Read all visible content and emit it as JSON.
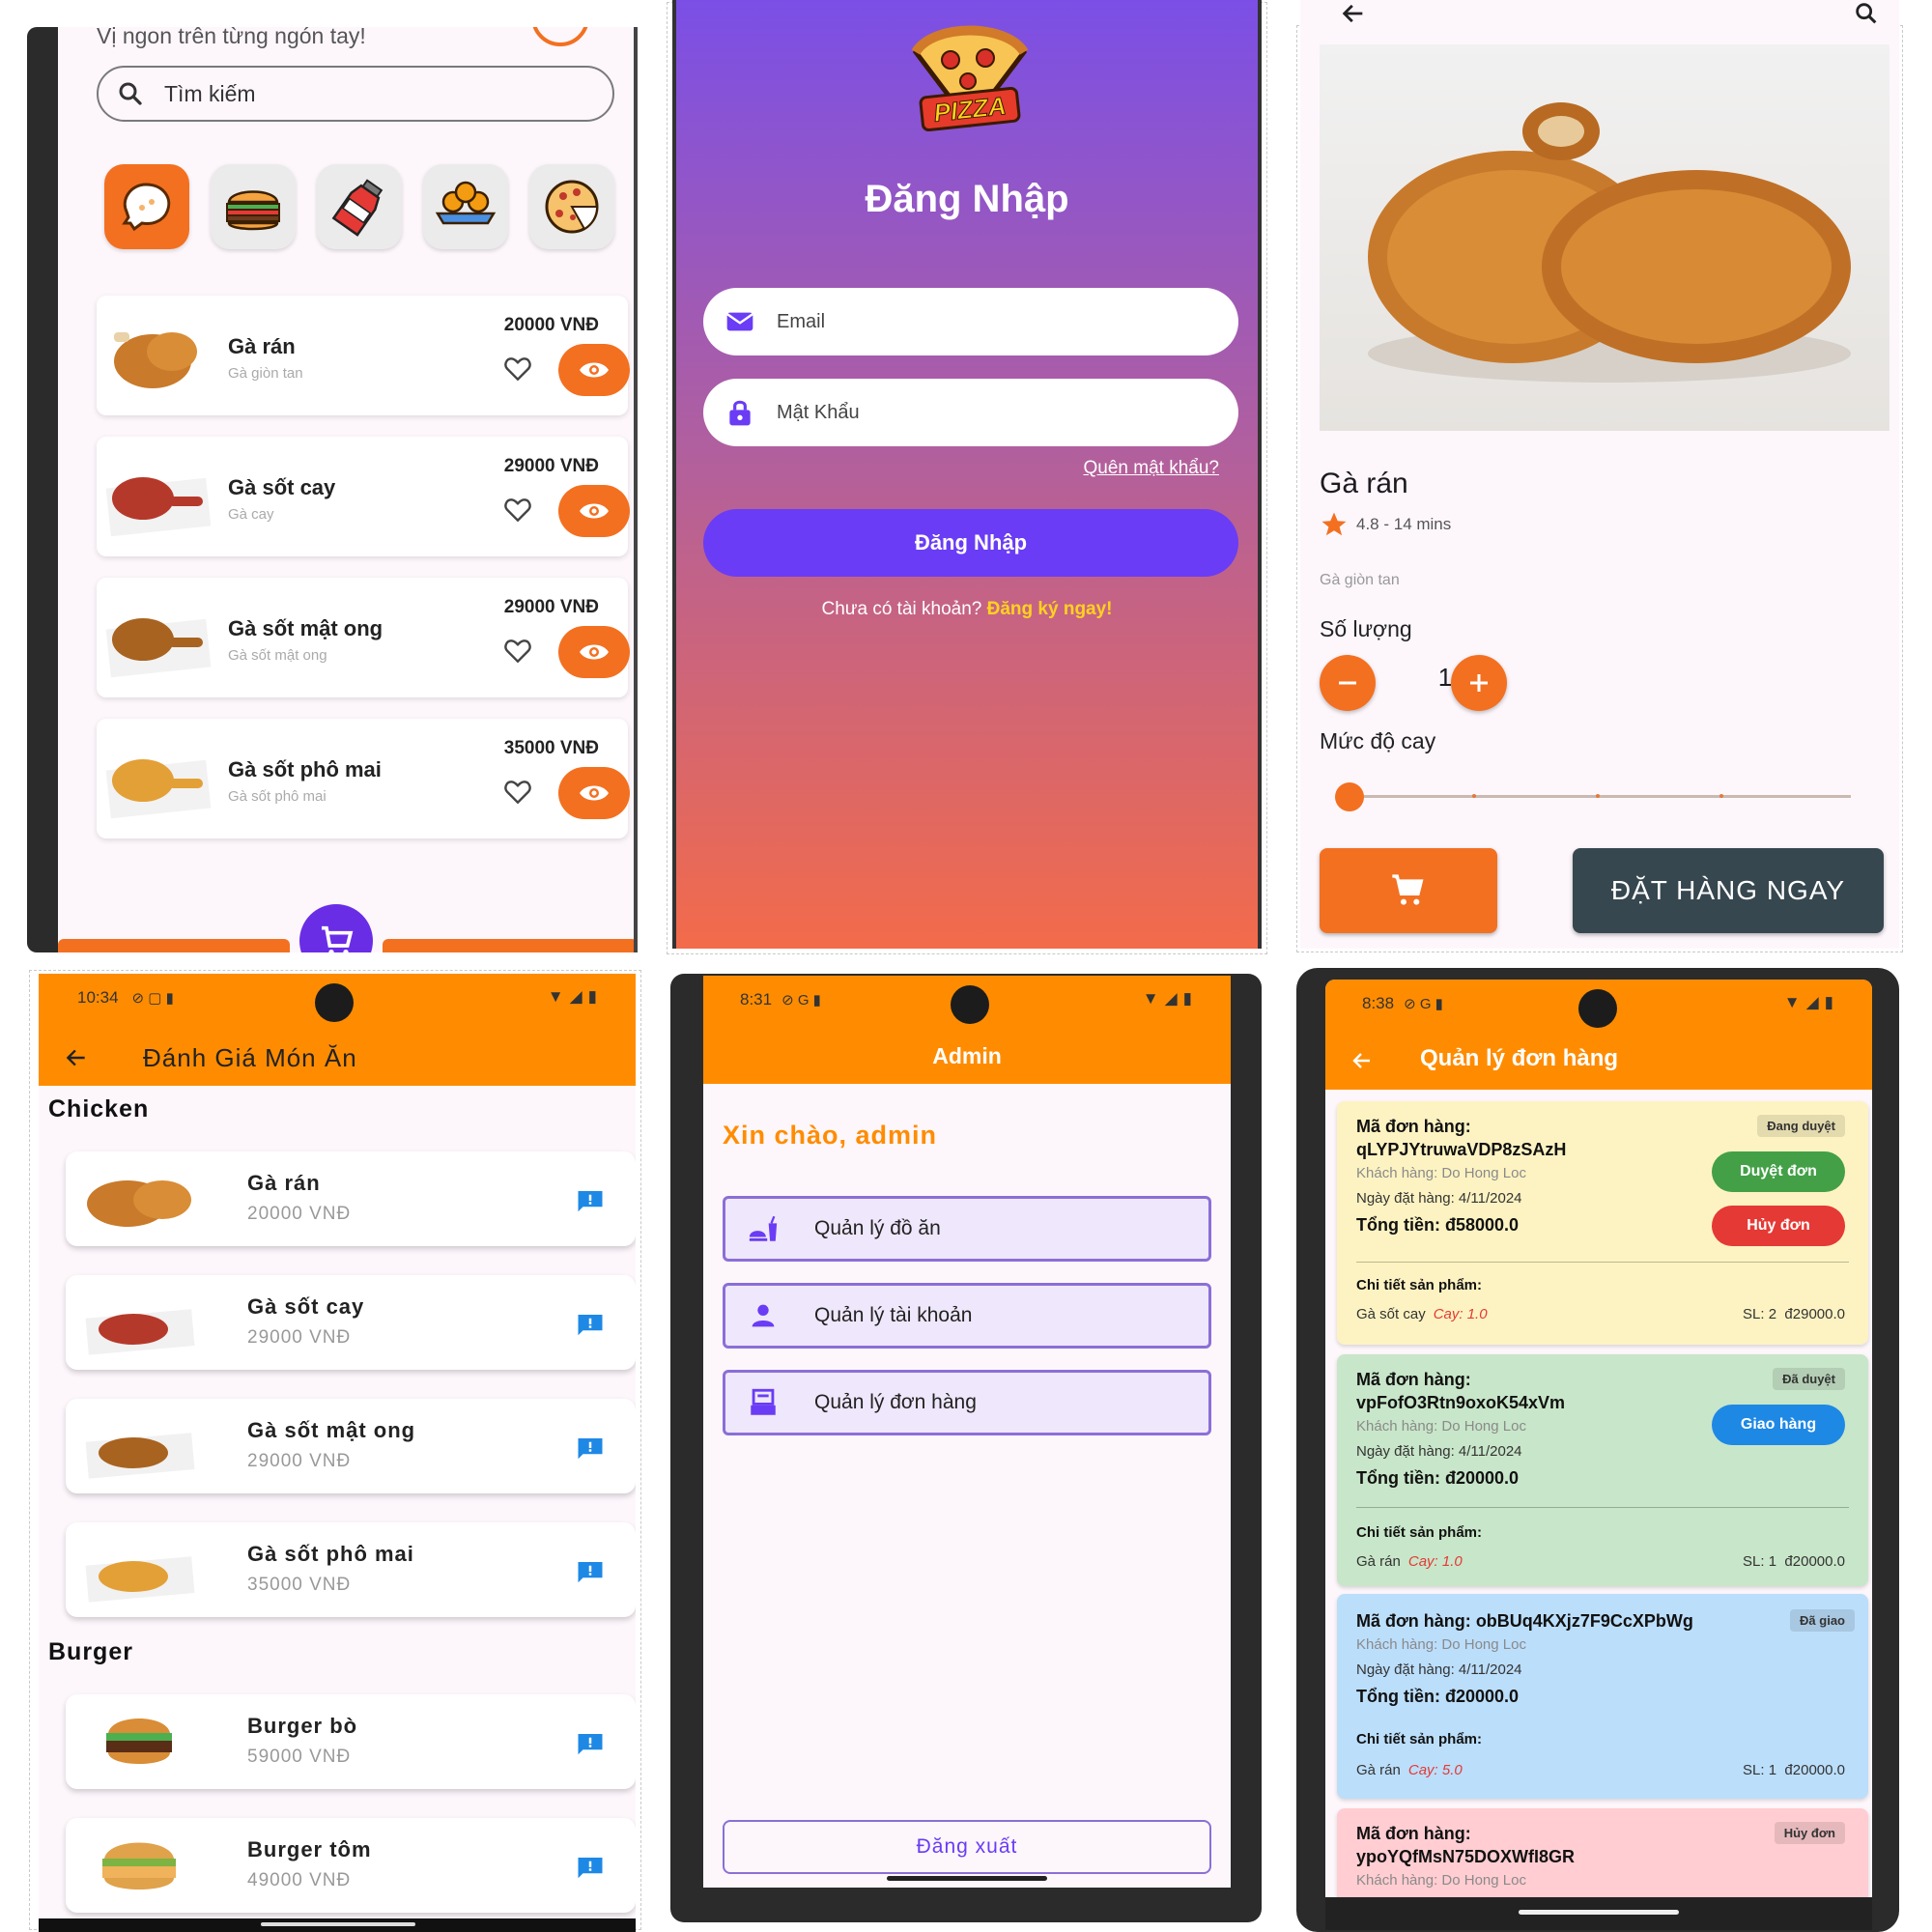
{
  "menu_screen": {
    "tagline": "Vị ngon trên từng ngón tay!",
    "search": {
      "placeholder": "Tìm kiếm"
    },
    "categories": [
      {
        "icon": "chicken-icon",
        "active": true
      },
      {
        "icon": "burger-icon",
        "active": false
      },
      {
        "icon": "drink-icon",
        "active": false
      },
      {
        "icon": "dish-icon",
        "active": false
      },
      {
        "icon": "pizza-icon",
        "active": false
      }
    ],
    "items": [
      {
        "name": "Gà rán",
        "desc": "Gà giòn tan",
        "price": "20000 VNĐ"
      },
      {
        "name": "Gà sốt cay",
        "desc": "Gà cay",
        "price": "29000 VNĐ"
      },
      {
        "name": "Gà sốt mật ong",
        "desc": "Gà sốt mật ong",
        "price": "29000 VNĐ"
      },
      {
        "name": "Gà sốt phô mai",
        "desc": "Gà sốt phô mai",
        "price": "35000 VNĐ"
      }
    ],
    "accent": "#f37021"
  },
  "login_screen": {
    "logo_text": "PIZZA",
    "title": "Đăng Nhập",
    "email_placeholder": "Email",
    "password_placeholder": "Mật Khẩu",
    "forgot": "Quên mật khẩu?",
    "submit": "Đăng Nhập",
    "no_account": "Chưa có tài khoản?",
    "register": "Đăng ký ngay!",
    "gradient": [
      "#7b4fe6",
      "#f36b4a"
    ]
  },
  "detail_screen": {
    "title": "Gà rán",
    "rating": "4.8 - 14 mins",
    "desc": "Gà giòn tan",
    "qty_label": "Số lượng",
    "qty": "1",
    "spice_label": "Mức độ cay",
    "spice_level": 0,
    "order_button": "ĐẶT HÀNG NGAY"
  },
  "rating_screen": {
    "status_time": "10:34",
    "title": "Đánh Giá Món Ăn",
    "sections": [
      {
        "title": "Chicken",
        "items": [
          {
            "name": "Gà rán",
            "price": "20000 VNĐ"
          },
          {
            "name": "Gà sốt cay",
            "price": "29000 VNĐ"
          },
          {
            "name": "Gà sốt mật ong",
            "price": "29000 VNĐ"
          },
          {
            "name": "Gà sốt phô mai",
            "price": "35000 VNĐ"
          }
        ]
      },
      {
        "title": "Burger",
        "items": [
          {
            "name": "Burger bò",
            "price": "59000 VNĐ"
          },
          {
            "name": "Burger tôm",
            "price": "49000 VNĐ"
          }
        ]
      }
    ],
    "appbar_color": "#ff8c00"
  },
  "admin_screen": {
    "status_time": "8:31",
    "title": "Admin",
    "greeting": "Xin chào, admin",
    "buttons": [
      "Quản lý đồ ăn",
      "Quản lý tài khoản",
      "Quản lý đơn hàng"
    ],
    "logout": "Đăng xuất"
  },
  "orders_screen": {
    "status_time": "8:38",
    "title": "Quản lý đơn hàng",
    "orders": [
      {
        "code_label": "Mã đơn hàng:",
        "code": "qLYPJYtruwaVDP8zSAzH",
        "status": "Đang duyệt",
        "customer": "Khách hàng: Do Hong Loc",
        "date": "Ngày đặt hàng: 4/11/2024",
        "total": "Tổng tiền: đ58000.0",
        "actions": [
          "Duyệt đơn",
          "Hủy đơn"
        ],
        "details_label": "Chi tiết sản phẩm:",
        "line": {
          "name": "Gà sốt cay",
          "spicy": "Cay: 1.0",
          "qty": "SL: 2",
          "price": "đ29000.0"
        },
        "bg": "#fdf3c2"
      },
      {
        "code_label": "Mã đơn hàng:",
        "code": "vpFofO3Rtn9oxoK54xVm",
        "status": "Đã duyệt",
        "customer": "Khách hàng: Do Hong Loc",
        "date": "Ngày đặt hàng: 4/11/2024",
        "total": "Tổng tiền: đ20000.0",
        "actions": [
          "Giao hàng"
        ],
        "details_label": "Chi tiết sản phẩm:",
        "line": {
          "name": "Gà rán",
          "spicy": "Cay: 1.0",
          "qty": "SL: 1",
          "price": "đ20000.0"
        },
        "bg": "#c8e6c9"
      },
      {
        "code_label": "Mã đơn hàng:",
        "code": "obBUq4KXjz7F9CcXPbWg",
        "status": "Đã giao",
        "customer": "Khách hàng: Do Hong Loc",
        "date": "Ngày đặt hàng: 4/11/2024",
        "total": "Tổng tiền: đ20000.0",
        "actions": [],
        "details_label": "Chi tiết sản phẩm:",
        "line": {
          "name": "Gà rán",
          "spicy": "Cay: 5.0",
          "qty": "SL: 1",
          "price": "đ20000.0"
        },
        "bg": "#bbdefb"
      },
      {
        "code_label": "Mã đơn hàng:",
        "code": "ypoYQfMsN75DOXWfI8GR",
        "status": "Hủy đơn",
        "customer": "Khách hàng: Do Hong Loc",
        "bg": "#ffcdd2"
      }
    ]
  }
}
